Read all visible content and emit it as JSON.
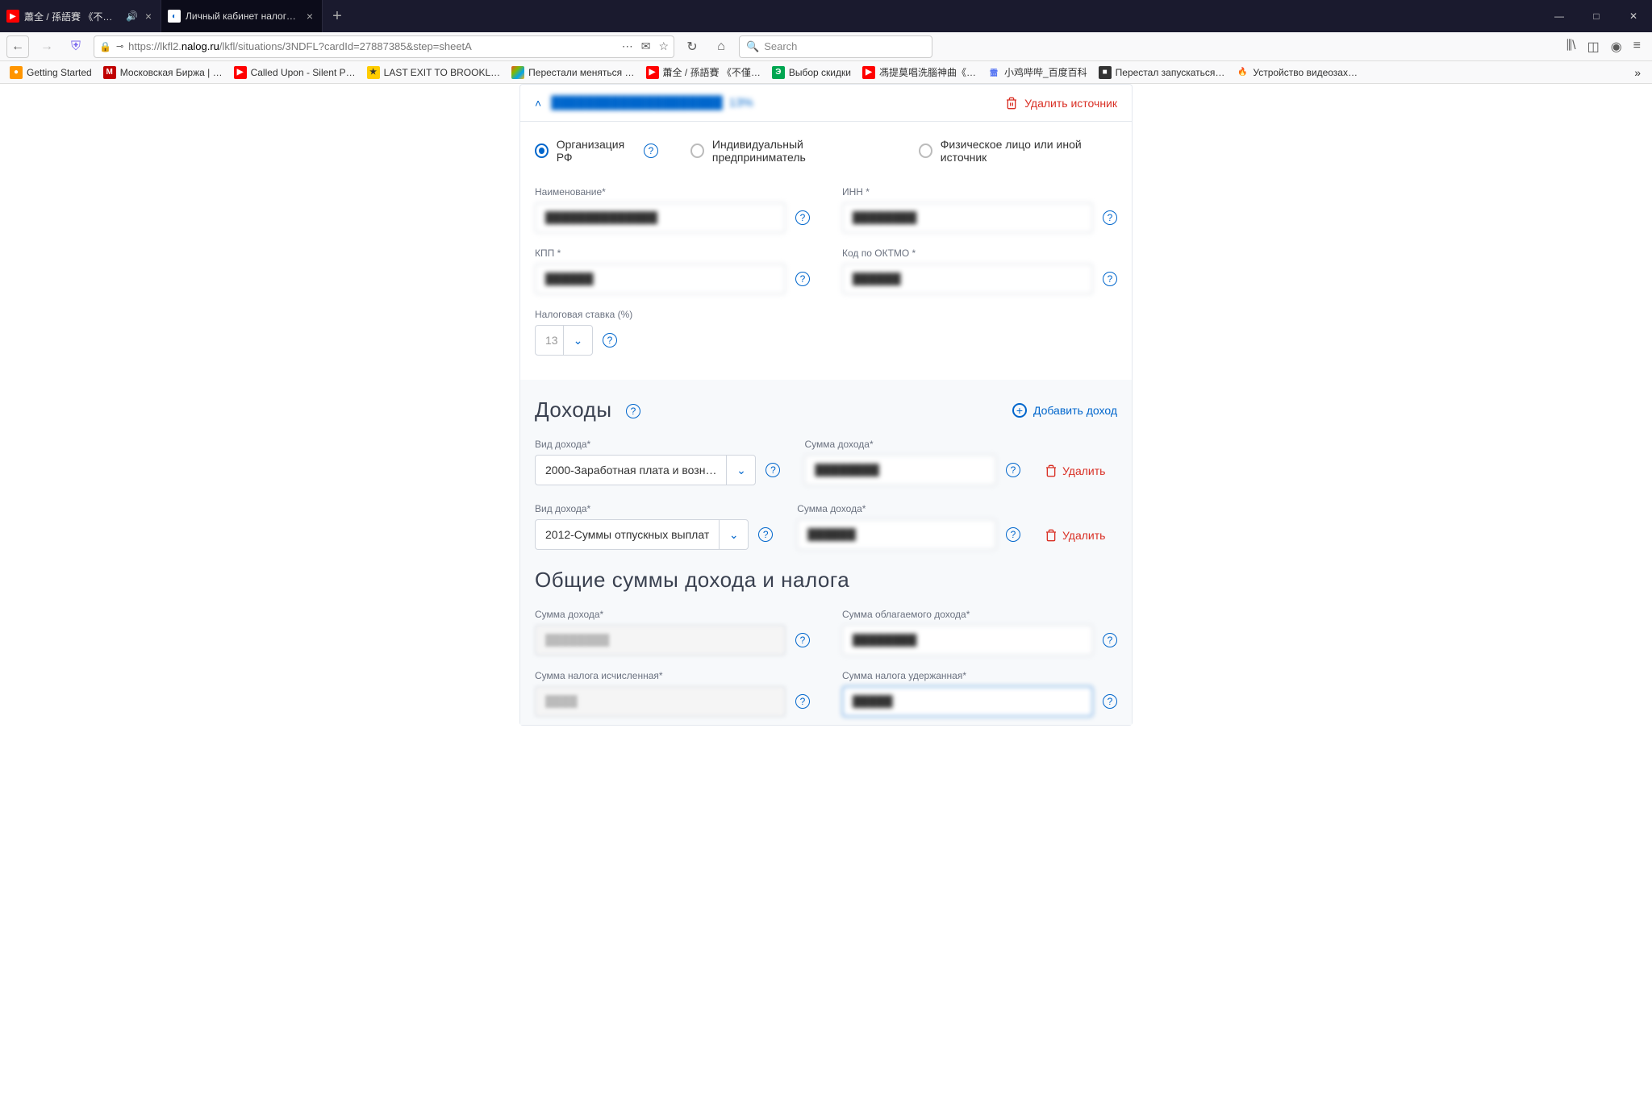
{
  "window": {
    "tabs": [
      {
        "title": "蕭全 / 孫語賽 《不僅僅是喜…",
        "audio": true
      },
      {
        "title": "Личный кабинет налогоплате…"
      }
    ]
  },
  "nav": {
    "url_prefix": "https://lkfl2.",
    "url_domain": "nalog.ru",
    "url_suffix": "/lkfl/situations/3NDFL?cardId=27887385&step=sheetA",
    "search_placeholder": "Search"
  },
  "bookmarks": [
    {
      "label": "Getting Started",
      "color": "#ff9500"
    },
    {
      "label": "Московская Биржа | …",
      "color": "#c00000"
    },
    {
      "label": "Called Upon - Silent P…",
      "color": "#f00"
    },
    {
      "label": "LAST EXIT TO BROOKL…",
      "color": "#ffcc00"
    },
    {
      "label": "Перестали меняться …",
      "color": "#00a4ef"
    },
    {
      "label": "蕭全 / 孫語賽 《不僅…",
      "color": "#f00"
    },
    {
      "label": "Выбор скидки",
      "color": "#00a651"
    },
    {
      "label": "馮提莫唱洗腦神曲《…",
      "color": "#f00"
    },
    {
      "label": "小鸡哔哔_百度百科",
      "color": "#4e6ef2"
    },
    {
      "label": "Перестал запускаться…",
      "color": "#333"
    },
    {
      "label": "Устройство видеозах…",
      "color": "#ff6600"
    }
  ],
  "source": {
    "title_masked": "████████████████████",
    "title_pct": "13%",
    "delete_label": "Удалить источник",
    "radios": {
      "org": "Организация РФ",
      "ip": "Индивидуальный предприниматель",
      "other": "Физическое лицо или иной источник"
    },
    "fields": {
      "name_label": "Наименование*",
      "name_value": "██████████████",
      "inn_label": "ИНН *",
      "inn_value": "████████",
      "kpp_label": "КПП *",
      "kpp_value": "██████",
      "oktmo_label": "Код по ОКТМО *",
      "oktmo_value": "██████",
      "rate_label": "Налоговая ставка (%)",
      "rate_value": "13"
    }
  },
  "incomes": {
    "title": "Доходы",
    "add_label": "Добавить доход",
    "type_label": "Вид дохода*",
    "amount_label": "Сумма дохода*",
    "delete_label": "Удалить",
    "rows": [
      {
        "type": "2000-Заработная плата и возн…",
        "amount": "████████"
      },
      {
        "type": "2012-Суммы отпускных выплат",
        "amount": "██████"
      }
    ]
  },
  "totals": {
    "title": "Общие суммы дохода и налога",
    "income_label": "Сумма дохода*",
    "income_value": "████████",
    "taxable_label": "Сумма облагаемого дохода*",
    "taxable_value": "████████",
    "calc_label": "Сумма налога исчисленная*",
    "calc_value": "████",
    "withheld_label": "Сумма налога удержанная*",
    "withheld_value": "█████"
  }
}
